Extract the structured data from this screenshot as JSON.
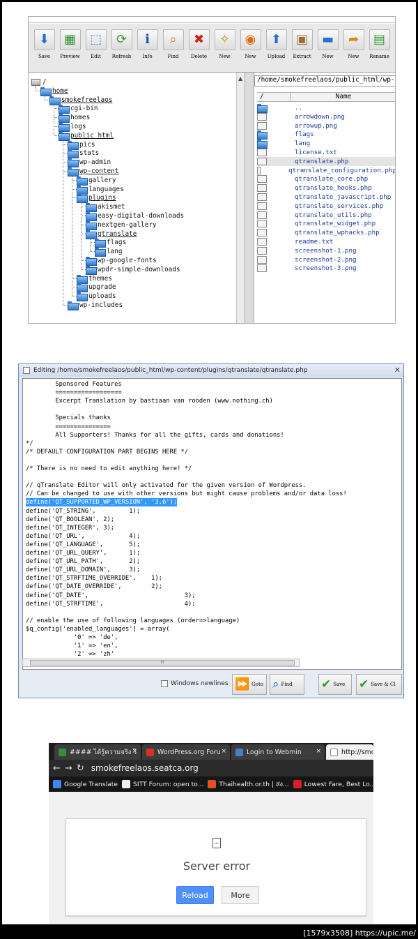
{
  "file_manager": {
    "toolbar": [
      {
        "label": "Save",
        "icon": "save-icon",
        "glyph": "⬇",
        "color": "#2a6fd0"
      },
      {
        "label": "Preview",
        "icon": "preview-icon",
        "glyph": "▦",
        "color": "#2f8f2f"
      },
      {
        "label": "Edit",
        "icon": "edit-icon",
        "glyph": "⬚",
        "color": "#3a78c8"
      },
      {
        "label": "Refresh",
        "icon": "refresh-icon",
        "glyph": "⟳",
        "color": "#3a9a2a"
      },
      {
        "label": "Info",
        "icon": "info-icon",
        "glyph": "ℹ",
        "color": "#1f4fb0"
      },
      {
        "label": "Find",
        "icon": "find-icon",
        "glyph": "⌕",
        "color": "#c08a20"
      },
      {
        "label": "Delete",
        "icon": "delete-icon",
        "glyph": "✖",
        "color": "#d02020"
      },
      {
        "label": "New",
        "icon": "new-file-icon",
        "glyph": "✧",
        "color": "#c09020"
      },
      {
        "label": "New",
        "icon": "browser-icon",
        "glyph": "◉",
        "color": "#e06a10"
      },
      {
        "label": "Upload",
        "icon": "upload-icon",
        "glyph": "⬆",
        "color": "#2a6fd0"
      },
      {
        "label": "Extract",
        "icon": "extract-icon",
        "glyph": "▣",
        "color": "#a06a2a"
      },
      {
        "label": "New",
        "icon": "new-folder-icon",
        "glyph": "▬",
        "color": "#2a6fd0"
      },
      {
        "label": "New",
        "icon": "new-link-icon",
        "glyph": "➦",
        "color": "#d08a10"
      },
      {
        "label": "Rename",
        "icon": "rename-icon",
        "glyph": "▤",
        "color": "#2f9a2f"
      }
    ],
    "tree": [
      {
        "label": "/",
        "depth": 0,
        "open": false,
        "drive": true
      },
      {
        "label": "home",
        "depth": 1,
        "open": true
      },
      {
        "label": "smokefreelaos",
        "depth": 2,
        "open": true
      },
      {
        "label": "cgi-bin",
        "depth": 3
      },
      {
        "label": "homes",
        "depth": 3
      },
      {
        "label": "logs",
        "depth": 3
      },
      {
        "label": "public html",
        "depth": 3,
        "open": true
      },
      {
        "label": "pics",
        "depth": 4
      },
      {
        "label": "stats",
        "depth": 4
      },
      {
        "label": "wp-admin",
        "depth": 4
      },
      {
        "label": "wp-content",
        "depth": 4,
        "open": true
      },
      {
        "label": "gallery",
        "depth": 5
      },
      {
        "label": "languages",
        "depth": 5
      },
      {
        "label": "plugins",
        "depth": 5,
        "open": true
      },
      {
        "label": "akismet",
        "depth": 6
      },
      {
        "label": "easy-digital-downloads",
        "depth": 6
      },
      {
        "label": "nextgen-gallery",
        "depth": 6
      },
      {
        "label": "qtranslate",
        "depth": 6,
        "open": true
      },
      {
        "label": "flags",
        "depth": 7
      },
      {
        "label": "lang",
        "depth": 7
      },
      {
        "label": "wp-google-fonts",
        "depth": 6
      },
      {
        "label": "wpdr-simple-downloads",
        "depth": 6
      },
      {
        "label": "themes",
        "depth": 5
      },
      {
        "label": "upgrade",
        "depth": 5
      },
      {
        "label": "uploads",
        "depth": 5
      },
      {
        "label": "wp-includes",
        "depth": 4
      }
    ],
    "path": "/home/smokefreelaos/public_html/wp-co",
    "list_header": {
      "col1": "/",
      "col2": "Name"
    },
    "files": [
      {
        "name": "..",
        "type": "dir"
      },
      {
        "name": "arrowdown.png",
        "type": "file"
      },
      {
        "name": "arrowup.png",
        "type": "file"
      },
      {
        "name": "flags",
        "type": "dir"
      },
      {
        "name": "lang",
        "type": "dir"
      },
      {
        "name": "license.txt",
        "type": "file"
      },
      {
        "name": "qtranslate.php",
        "type": "file",
        "selected": true
      },
      {
        "name": "qtranslate_configuration.php",
        "type": "file"
      },
      {
        "name": "qtranslate_core.php",
        "type": "file"
      },
      {
        "name": "qtranslate_hooks.php",
        "type": "file"
      },
      {
        "name": "qtranslate_javascript.php",
        "type": "file"
      },
      {
        "name": "qtranslate_services.php",
        "type": "file"
      },
      {
        "name": "qtranslate_utils.php",
        "type": "file"
      },
      {
        "name": "qtranslate_widget.php",
        "type": "file"
      },
      {
        "name": "qtranslate_wphacks.php",
        "type": "file"
      },
      {
        "name": "readme.txt",
        "type": "file"
      },
      {
        "name": "screenshot-1.png",
        "type": "file"
      },
      {
        "name": "screenshot-2.png",
        "type": "file"
      },
      {
        "name": "screenshot-3.png",
        "type": "file"
      }
    ]
  },
  "editor": {
    "title": "Editing /home/smokefreelaos/public_html/wp-content/plugins/qtranslate/qtranslate.php",
    "lines": [
      {
        "text": "        Sponsored Features"
      },
      {
        "text": "        =================="
      },
      {
        "text": "        Excerpt Translation by bastiaan van rooden (www.nothing.ch)"
      },
      {
        "text": ""
      },
      {
        "text": "        Specials thanks"
      },
      {
        "text": "        ==============="
      },
      {
        "text": "        All Supporters! Thanks for all the gifts, cards and donations!"
      },
      {
        "text": "*/"
      },
      {
        "text": "/* DEFAULT CONFIGURATION PART BEGINS HERE */"
      },
      {
        "text": ""
      },
      {
        "text": "/* There is no need to edit anything here! */"
      },
      {
        "text": ""
      },
      {
        "text": "// qTranslate Editor will only activated for the given version of Wordpress."
      },
      {
        "text": "// Can be changed to use with other versions but might cause problems and/or data loss!"
      },
      {
        "text": "define('QT_SUPPORTED_WP_VERSION', '3.6');",
        "highlight": true
      },
      {
        "text": "define('QT_STRING',         1);"
      },
      {
        "text": "define('QT_BOOLEAN', 2);"
      },
      {
        "text": "define('QT_INTEGER', 3);"
      },
      {
        "text": "define('QT_URL',            4);"
      },
      {
        "text": "define('QT_LANGUAGE',       5);"
      },
      {
        "text": "define('QT_URL_QUERY',      1);"
      },
      {
        "text": "define('QT_URL_PATH',       2);"
      },
      {
        "text": "define('QT_URL_DOMAIN',     3);"
      },
      {
        "text": "define('QT_STRFTIME_OVERRIDE',    1);"
      },
      {
        "text": "define('QT_DATE_OVERRIDE',        2);"
      },
      {
        "text": "define('QT_DATE',                          3);"
      },
      {
        "text": "define('QT_STRFTIME',                      4);"
      },
      {
        "text": ""
      },
      {
        "text": "// enable the use of following languages (order=>language)"
      },
      {
        "text": "$q_config['enabled_languages'] = array("
      },
      {
        "text": "             '0' => 'de',"
      },
      {
        "text": "             '1' => 'en',"
      },
      {
        "text": "             '2' => 'zh'"
      }
    ],
    "scroll_grip": "III",
    "checkbox_label": "Windows newlines",
    "buttons": [
      {
        "label": "Goto",
        "icon": "goto-icon",
        "glyph": "⏩",
        "color": "#2a6fd0"
      },
      {
        "label": "Find",
        "icon": "find-icon",
        "glyph": "⌕",
        "color": "#2a6fd0"
      },
      {
        "label": "Save",
        "icon": "save-check-icon",
        "glyph": "✔",
        "color": "#2f9a2f"
      },
      {
        "label": "Save & Cl",
        "icon": "save-close-icon",
        "glyph": "✔",
        "color": "#2f9a2f"
      }
    ]
  },
  "browser": {
    "tabs": [
      {
        "label": "#### ได้รู้ความจริง ไ",
        "icon": "tab-favicon",
        "color": "#3c8a3c"
      },
      {
        "label": "WordPress.org Foru",
        "icon": "gmail-icon",
        "color": "#d93025"
      },
      {
        "label": "Login to Webmin",
        "icon": "webmin-icon",
        "color": "#4a7cc8"
      },
      {
        "label": "http://smok",
        "icon": "page-icon",
        "color": "#ffffff",
        "active": true
      }
    ],
    "url": "smokefreelaos.seatca.org",
    "bookmarks": [
      {
        "label": "Google Translate",
        "icon": "google-translate-icon",
        "color": "#4285f4"
      },
      {
        "label": "SITT Forum: open to...",
        "icon": "sitt-icon",
        "color": "#eeeeee"
      },
      {
        "label": "Thaihealth.or.th | ส่ง...",
        "icon": "thaihealth-icon",
        "color": "#e05020"
      },
      {
        "label": "Lowest Fare, Best Lo...",
        "icon": "airasia-icon",
        "color": "#d61f26"
      }
    ],
    "error_title": "Server error",
    "reload_label": "Reload",
    "more_label": "More"
  },
  "footer": "[1579x3508] https://upic.me/"
}
